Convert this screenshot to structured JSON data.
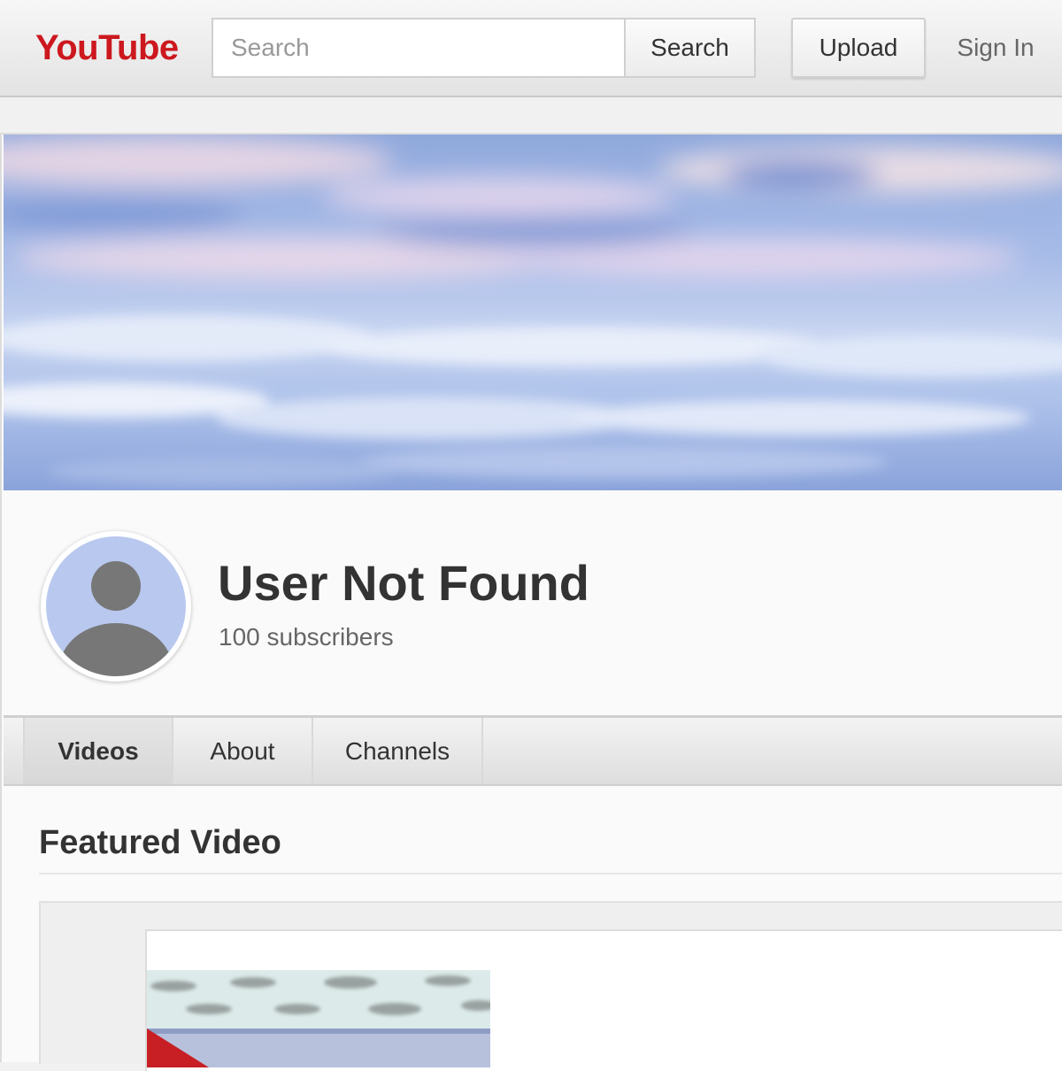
{
  "masthead": {
    "logo": "YouTube",
    "search_placeholder": "Search",
    "search_button": "Search",
    "upload_button": "Upload",
    "signin_link": "Sign In"
  },
  "channel": {
    "title": "User Not Found",
    "subscribers": "100 subscribers"
  },
  "tabs": [
    {
      "label": "Videos",
      "active": true
    },
    {
      "label": "About",
      "active": false
    },
    {
      "label": "Channels",
      "active": false
    }
  ],
  "featured": {
    "heading": "Featured Video"
  },
  "colors": {
    "brand": "#cc181e",
    "avatar_bg": "#b9c8ee",
    "avatar_figure": "#777777"
  }
}
